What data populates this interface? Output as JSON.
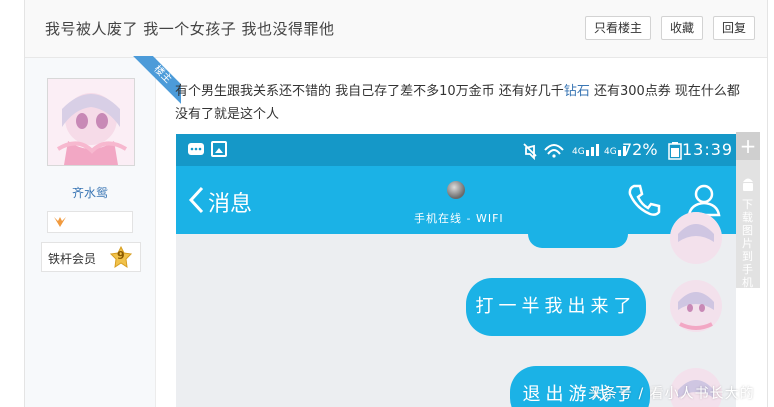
{
  "header": {
    "title": "我号被人废了 我一个女孩子 我也没得罪他",
    "buttons": [
      "只看楼主",
      "收藏",
      "回复"
    ]
  },
  "sidebar": {
    "ribbon": "楼主",
    "username": "齐水鸳",
    "level_label": "铁杆会员",
    "level_num": "9"
  },
  "post": {
    "text_pre": "有个男生跟我关系还不错的 我自己存了差不多10万金币 还有好几千",
    "text_highlight": "钻石",
    "text_post": " 还有300点券 现在什么都没有了就是这个人"
  },
  "phone": {
    "status_right": "72%",
    "time": "13:39",
    "network": "4G 4G",
    "back_label": "消息",
    "status_line": "手机在线 - WIFI",
    "msg1": "打一半我出来了",
    "msg2": "退出游戏了"
  },
  "side_tool": {
    "label": "下载图片到手机"
  },
  "watermark": "头条号 / 看小人书长大的"
}
